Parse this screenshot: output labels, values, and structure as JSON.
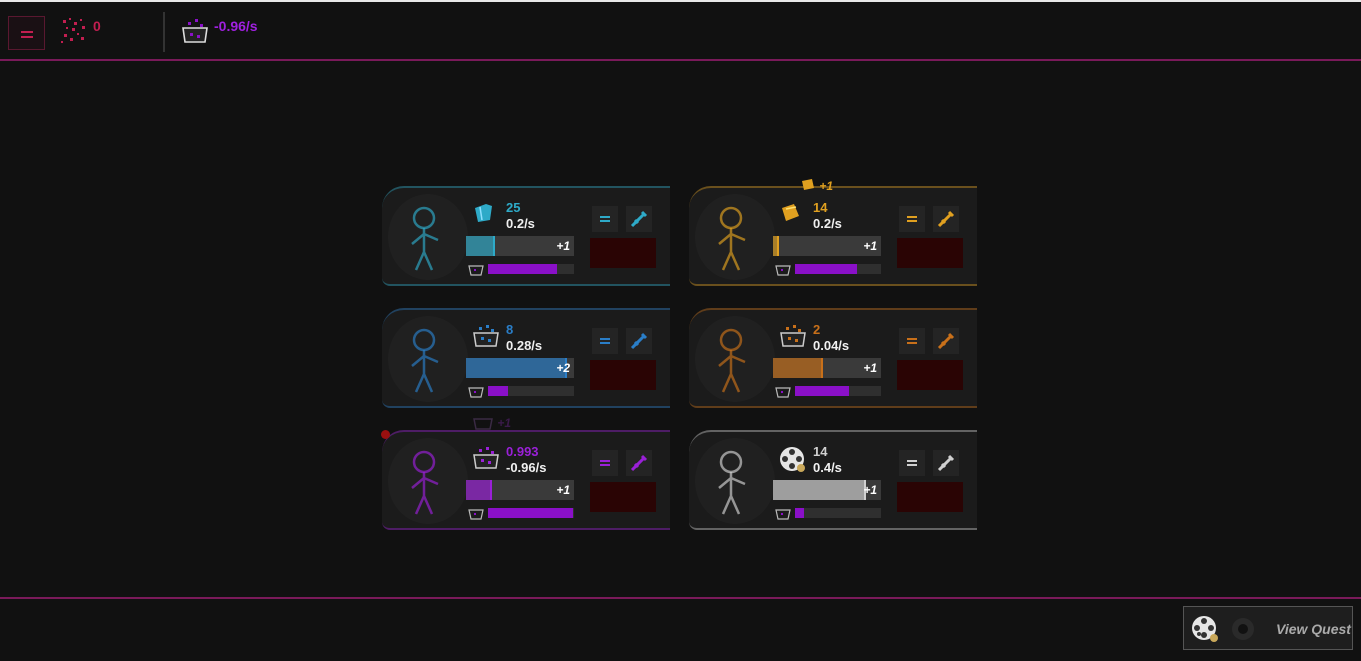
{
  "topbar": {
    "menu_icon": "hamburger-icon",
    "resource_1": {
      "icon": "pink-particles-icon",
      "value": "0"
    },
    "resource_2": {
      "icon": "purple-cauldron-icon",
      "value": "-0.96/s"
    }
  },
  "quest_panel": {
    "label": "View Quest",
    "icons": [
      "film-reel-icon",
      "gear-icon"
    ]
  },
  "cards": [
    {
      "id": "builder",
      "color": "#2eaac8",
      "resource_icon": "blue-gem-icon",
      "count": "25",
      "rate": "0.2/s",
      "plus": "+1",
      "progress": 0.25,
      "secondary": 0.8,
      "figure": "stick-figure-with-door"
    },
    {
      "id": "smith",
      "color": "#e0a020",
      "resource_icon": "gold-ingot-icon",
      "count": "14",
      "rate": "0.2/s",
      "plus": "+1",
      "progress": 0.04,
      "secondary": 0.72,
      "figure": "stick-figure-at-forge"
    },
    {
      "id": "miner",
      "color": "#2a7ec8",
      "resource_icon": "ore-cauldron-icon",
      "count": "8",
      "rate": "0.28/s",
      "plus": "+2",
      "progress": 0.92,
      "secondary": 0.23,
      "figure": "stick-figure-with-pickaxe"
    },
    {
      "id": "digger",
      "color": "#c8701a",
      "resource_icon": "copper-ore-icon",
      "count": "2",
      "rate": "0.04/s",
      "plus": "+1",
      "progress": 0.44,
      "secondary": 0.63,
      "figure": "stick-figure-digging"
    },
    {
      "id": "alchemist",
      "color": "#9a20d8",
      "resource_icon": "purple-cauldron-icon",
      "count": "0.993",
      "rate": "-0.96/s",
      "plus": "+1",
      "progress": 0.22,
      "secondary": 0.99,
      "figure": "stick-figure-brewing"
    },
    {
      "id": "director",
      "color": "#d0d0d0",
      "resource_icon": "film-reel-icon",
      "count": "14",
      "rate": "0.4/s",
      "plus": "+1",
      "progress": 0.84,
      "secondary": 0.1,
      "figure": "stick-figure-grey"
    }
  ],
  "floaters": [
    {
      "icon": "gold-ingot-icon",
      "text": "+1",
      "color": "#e0a020"
    },
    {
      "icon": "purple-cauldron-icon",
      "text": "+1",
      "color": "#3a1a4a"
    }
  ],
  "colors": {
    "accent": "#7a1a5a",
    "danger": "#c21e50",
    "cauldron": "#8a10c8"
  }
}
